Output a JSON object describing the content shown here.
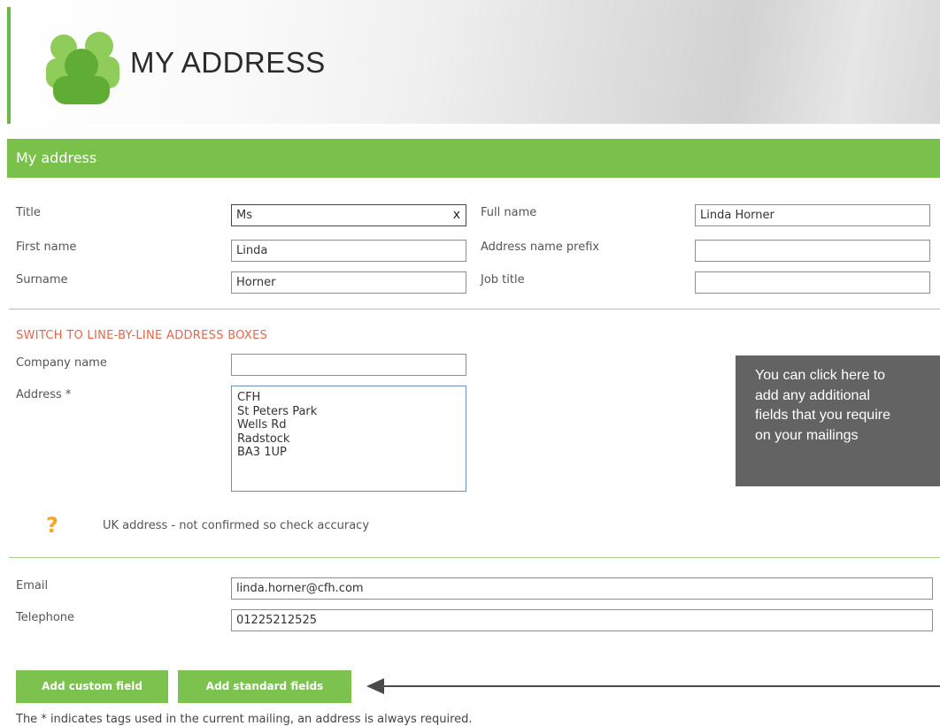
{
  "header": {
    "title": "MY ADDRESS",
    "icon": "users-group-icon",
    "accent_color": "#6ab942"
  },
  "section": {
    "title": "My address",
    "color": "#79c14a"
  },
  "fields": {
    "title": {
      "label": "Title",
      "value": "Ms"
    },
    "full_name": {
      "label": "Full name",
      "value": "Linda Horner"
    },
    "first_name": {
      "label": "First name",
      "value": "Linda"
    },
    "address_name_prefix": {
      "label": "Address name prefix",
      "value": ""
    },
    "surname": {
      "label": "Surname",
      "value": "Horner"
    },
    "job_title": {
      "label": "Job title",
      "value": ""
    },
    "company_name": {
      "label": "Company name",
      "value": ""
    },
    "address": {
      "label": "Address *",
      "lines": [
        "CFH",
        "St Peters Park",
        "Wells Rd",
        "Radstock",
        "BA3 1UP"
      ]
    },
    "email": {
      "label": "Email",
      "value": "linda.horner@cfh.com"
    },
    "telephone": {
      "label": "Telephone",
      "value": "01225212525"
    }
  },
  "clear_symbol": "x",
  "switch_link": "SWITCH TO LINE-BY-LINE ADDRESS BOXES",
  "address_warning": {
    "icon": "question-mark-icon",
    "symbol": "?",
    "text": "UK address - not confirmed so check accuracy"
  },
  "buttons": {
    "add_custom_field": "Add custom field",
    "add_standard_fields": "Add standard fields"
  },
  "footnote": "The * indicates tags used in the current mailing, an address is always required.",
  "annotation": {
    "lines": [
      "You can click here to",
      "add any additional",
      "fields that you require",
      "on your mailings"
    ]
  }
}
